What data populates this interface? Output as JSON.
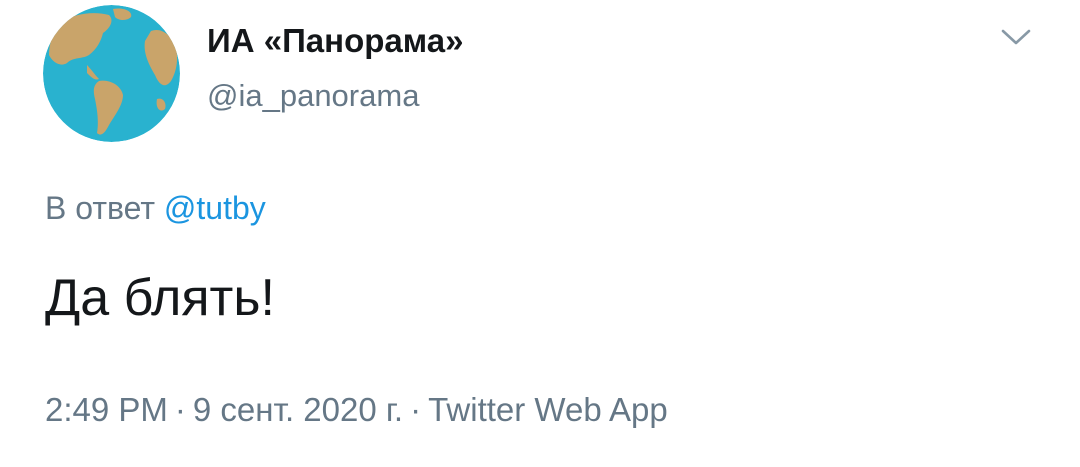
{
  "author": {
    "display_name": "ИА «Панорама»",
    "handle": "@ia_panorama",
    "avatar_icon": "globe-icon"
  },
  "menu": {
    "icon": "chevron-down-icon"
  },
  "reply": {
    "prefix": "В ответ",
    "mention": "@tutby"
  },
  "tweet": {
    "text": "Да блять!"
  },
  "meta": {
    "time": "2:49 PM",
    "separator": "·",
    "date": "9 сент. 2020 г.",
    "source": "Twitter Web App"
  },
  "colors": {
    "name": "#14171a",
    "secondary": "#657786",
    "link": "#1b95e0",
    "globe_water": "#29b2cf",
    "globe_land": "#c9a46a"
  }
}
